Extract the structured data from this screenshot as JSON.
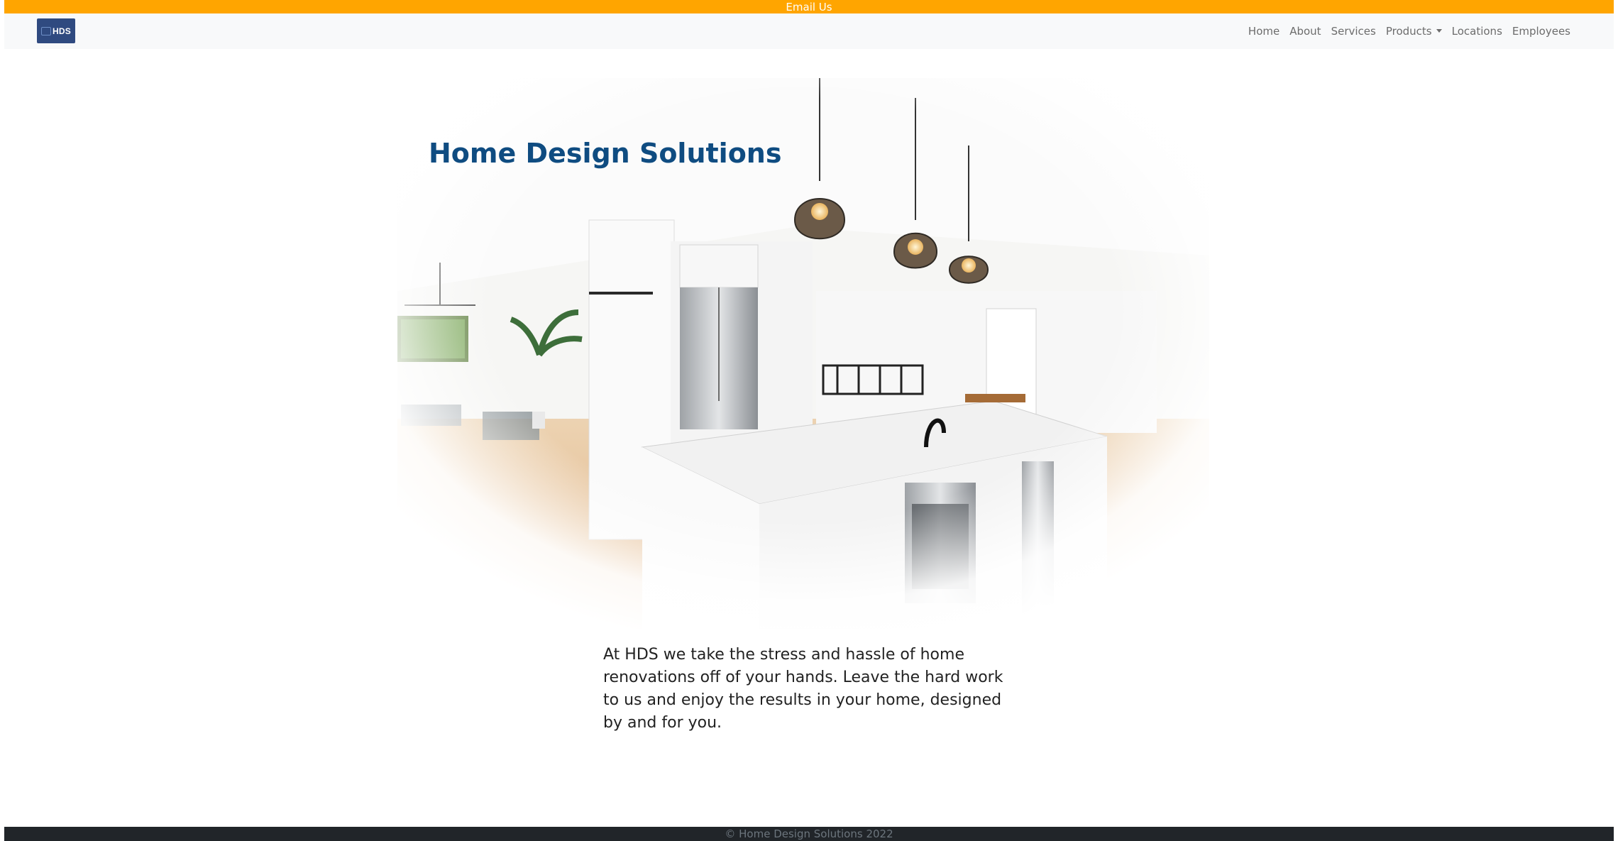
{
  "topbar": {
    "email_label": "Email Us"
  },
  "brand": {
    "logo_text": "HDS",
    "logo_color": "#2f4a80"
  },
  "nav": {
    "items": [
      {
        "label": "Home"
      },
      {
        "label": "About"
      },
      {
        "label": "Services"
      },
      {
        "label": "Products"
      },
      {
        "label": "Locations"
      },
      {
        "label": "Employees"
      }
    ]
  },
  "hero": {
    "title": "Home Design Solutions",
    "image_description_icon": "kitchen-photo",
    "text": "At HDS we take the stress and hassle of home renovations off of your hands. Leave the hard work to us and enjoy the results in your home, designed by and for you."
  },
  "footer": {
    "copyright": "© Home Design Solutions 2022"
  },
  "colors": {
    "topbar": "#ffa500",
    "navbar": "#f8f9fa",
    "title": "#0f4c81",
    "footer": "#212529"
  }
}
